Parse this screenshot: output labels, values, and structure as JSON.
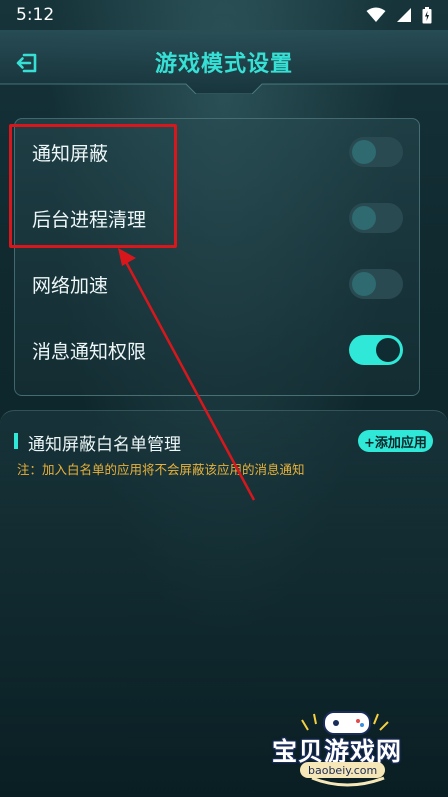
{
  "status_bar": {
    "time": "5:12"
  },
  "header": {
    "title": "游戏模式设置",
    "back_icon": "back-arrow-icon"
  },
  "settings": [
    {
      "label": "通知屏蔽",
      "enabled": false
    },
    {
      "label": "后台进程清理",
      "enabled": false
    },
    {
      "label": "网络加速",
      "enabled": false
    },
    {
      "label": "消息通知权限",
      "enabled": true
    }
  ],
  "whitelist": {
    "title": "通知屏蔽白名单管理",
    "add_button": "+添加应用",
    "note": "注：加入白名单的应用将不会屏蔽该应用的消息通知"
  },
  "watermark": {
    "name": "宝贝游戏网",
    "url": "baobeiy.com"
  },
  "colors": {
    "accent": "#2fe8d7",
    "highlight": "#d8171c",
    "note": "#e8b23a"
  }
}
